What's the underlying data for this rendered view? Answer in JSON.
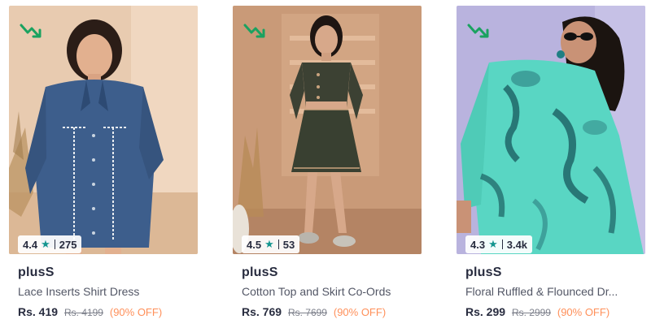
{
  "colors": {
    "star": "#14958f",
    "trend_arrow": "#1aa260",
    "discount": "#ff905a",
    "brand_text": "#282c3f",
    "title_text": "#535766",
    "mrp_text": "#7e818c"
  },
  "products": [
    {
      "brand": "plusS",
      "title": "Lace Inserts Shirt Dress",
      "rating": "4.4",
      "rating_count": "275",
      "price": "Rs. 419",
      "mrp": "Rs. 4199",
      "discount": "(90% OFF)",
      "icons": [
        "trending-down-icon",
        "star-icon"
      ]
    },
    {
      "brand": "plusS",
      "title": "Cotton Top and Skirt Co-Ords",
      "rating": "4.5",
      "rating_count": "53",
      "price": "Rs. 769",
      "mrp": "Rs. 7699",
      "discount": "(90% OFF)",
      "icons": [
        "trending-down-icon",
        "star-icon"
      ]
    },
    {
      "brand": "plusS",
      "title": "Floral Ruffled & Flounced Dr...",
      "rating": "4.3",
      "rating_count": "3.4k",
      "price": "Rs. 299",
      "mrp": "Rs. 2999",
      "discount": "(90% OFF)",
      "icons": [
        "trending-down-icon",
        "star-icon"
      ]
    }
  ]
}
